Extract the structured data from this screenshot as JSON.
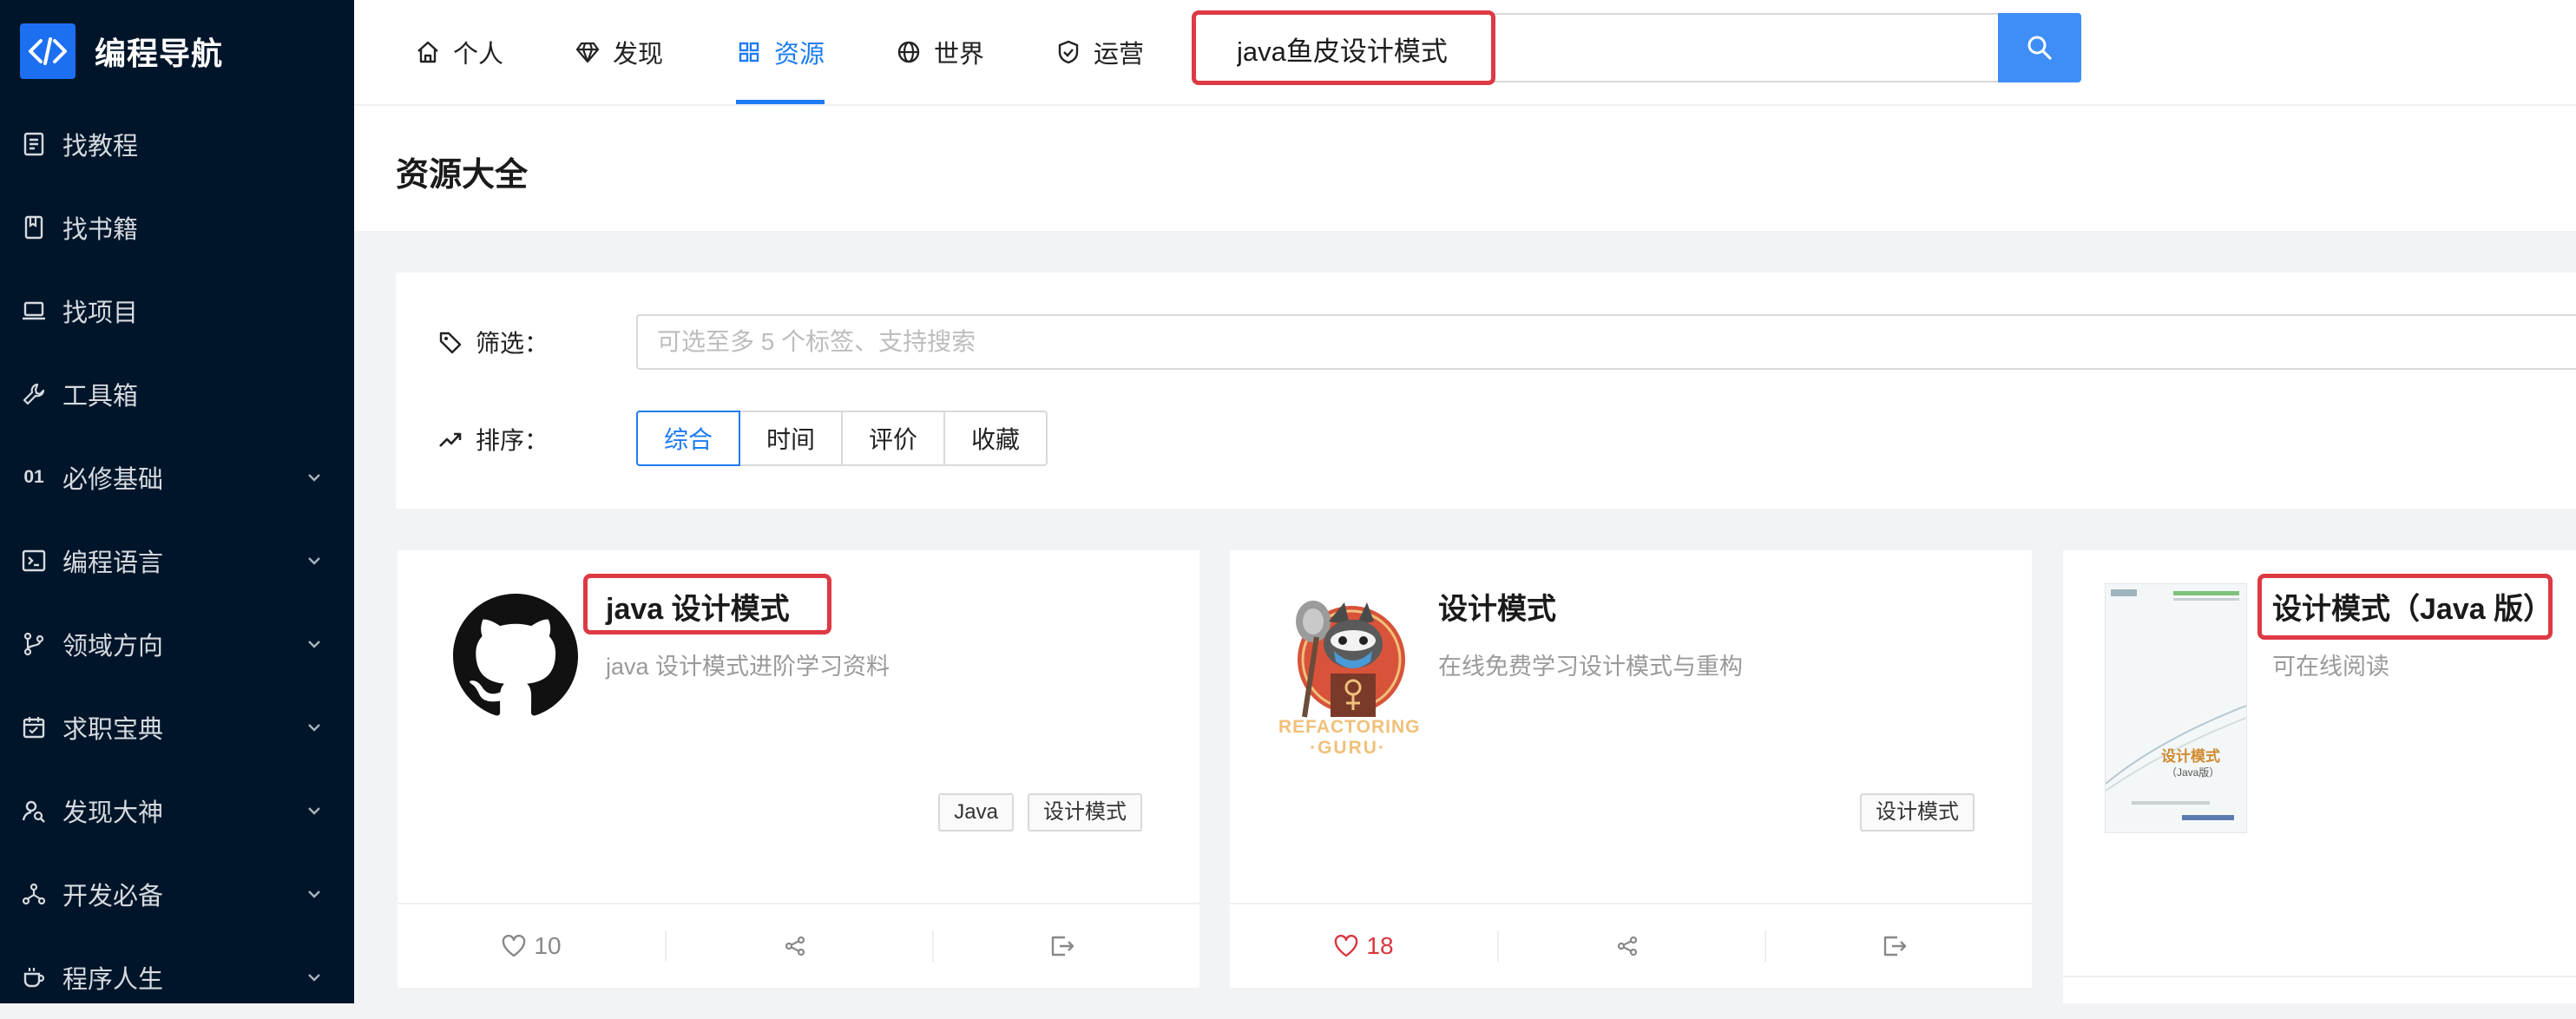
{
  "brand": {
    "title": "编程导航",
    "logo_icon": "code-brackets-icon"
  },
  "sidebar": {
    "items": [
      {
        "label": "找教程",
        "icon": "tutorial-icon",
        "expandable": false
      },
      {
        "label": "找书籍",
        "icon": "book-icon",
        "expandable": false
      },
      {
        "label": "找项目",
        "icon": "laptop-icon",
        "expandable": false
      },
      {
        "label": "工具箱",
        "icon": "wrench-icon",
        "expandable": false
      },
      {
        "label": "必修基础",
        "icon": "number-01",
        "prefix": "01",
        "expandable": true
      },
      {
        "label": "编程语言",
        "icon": "terminal-icon",
        "expandable": true
      },
      {
        "label": "领域方向",
        "icon": "branch-icon",
        "expandable": true
      },
      {
        "label": "求职宝典",
        "icon": "calendar-check-icon",
        "expandable": true
      },
      {
        "label": "发现大神",
        "icon": "user-search-icon",
        "expandable": true
      },
      {
        "label": "开发必备",
        "icon": "nodes-icon",
        "expandable": true
      },
      {
        "label": "程序人生",
        "icon": "coffee-icon",
        "expandable": true
      }
    ]
  },
  "topnav": {
    "tabs": [
      {
        "label": "个人",
        "icon": "home-icon",
        "active": false
      },
      {
        "label": "发现",
        "icon": "diamond-icon",
        "active": false
      },
      {
        "label": "资源",
        "icon": "grid-icon",
        "active": true
      },
      {
        "label": "世界",
        "icon": "globe-icon",
        "active": false
      },
      {
        "label": "运营",
        "icon": "shield-check-icon",
        "active": false
      }
    ],
    "search": {
      "value": "java鱼皮设计模式",
      "button_icon": "search-icon"
    }
  },
  "page": {
    "title": "资源大全"
  },
  "filters": {
    "filter_label": "筛选：",
    "filter_icon": "tag-icon",
    "tag_placeholder": "可选至多 5 个标签、支持搜索",
    "sort_label": "排序：",
    "sort_icon": "trend-icon",
    "sort_options": [
      "综合",
      "时间",
      "评价",
      "收藏"
    ],
    "sort_selected": "综合"
  },
  "cards": [
    {
      "title": "java 设计模式",
      "desc": "java 设计模式进阶学习资料",
      "thumb": "github-icon",
      "tags": [
        "Java",
        "设计模式"
      ],
      "likes": "10",
      "liked": false
    },
    {
      "title": "设计模式",
      "desc": "在线免费学习设计模式与重构",
      "thumb": "refactoring-guru-logo",
      "thumb_caption": [
        "REFACTORING",
        "·GURU·"
      ],
      "tags": [
        "设计模式"
      ],
      "likes": "18",
      "liked": true
    },
    {
      "title": "设计模式（Java 版）",
      "desc": "可在线阅读",
      "thumb": "book-cover",
      "cover_title": "设计模式",
      "cover_sub": "（Java版）",
      "tags": [],
      "likes": "",
      "liked": false
    }
  ],
  "colors": {
    "accent": "#1d7cf2",
    "sidebar_bg": "#001529",
    "highlight": "#dc3a44",
    "liked": "#d9363e"
  }
}
